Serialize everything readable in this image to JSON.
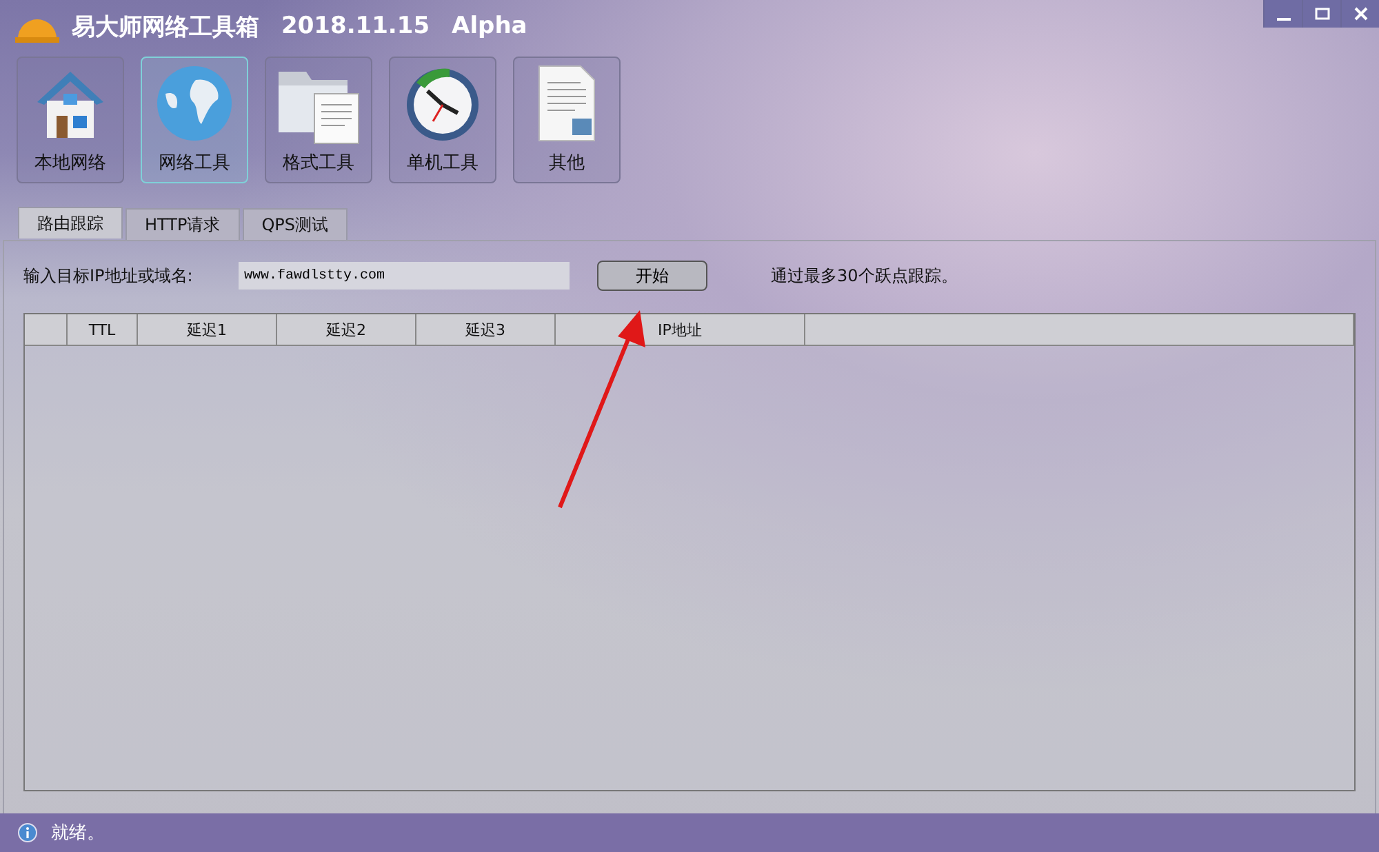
{
  "window": {
    "title": "易大师网络工具箱",
    "version": "2018.11.15",
    "edition": "Alpha"
  },
  "toolbar": [
    {
      "label": "本地网络",
      "kind": "house",
      "selected": false
    },
    {
      "label": "网络工具",
      "kind": "globe",
      "selected": true
    },
    {
      "label": "格式工具",
      "kind": "folder",
      "selected": false
    },
    {
      "label": "单机工具",
      "kind": "clock",
      "selected": false
    },
    {
      "label": "其他",
      "kind": "document",
      "selected": false
    }
  ],
  "tabs": [
    {
      "label": "路由跟踪",
      "selected": true
    },
    {
      "label": "HTTP请求",
      "selected": false
    },
    {
      "label": "QPS测试",
      "selected": false
    }
  ],
  "target": {
    "label": "输入目标IP地址或域名:",
    "value": "www.fawdlstty.com",
    "button": "开始",
    "hint": "通过最多30个跃点跟踪。"
  },
  "table": {
    "columns": [
      "",
      "TTL",
      "延迟1",
      "延迟2",
      "延迟3",
      "IP地址",
      ""
    ]
  },
  "status_bar": {
    "text": "就绪。"
  }
}
